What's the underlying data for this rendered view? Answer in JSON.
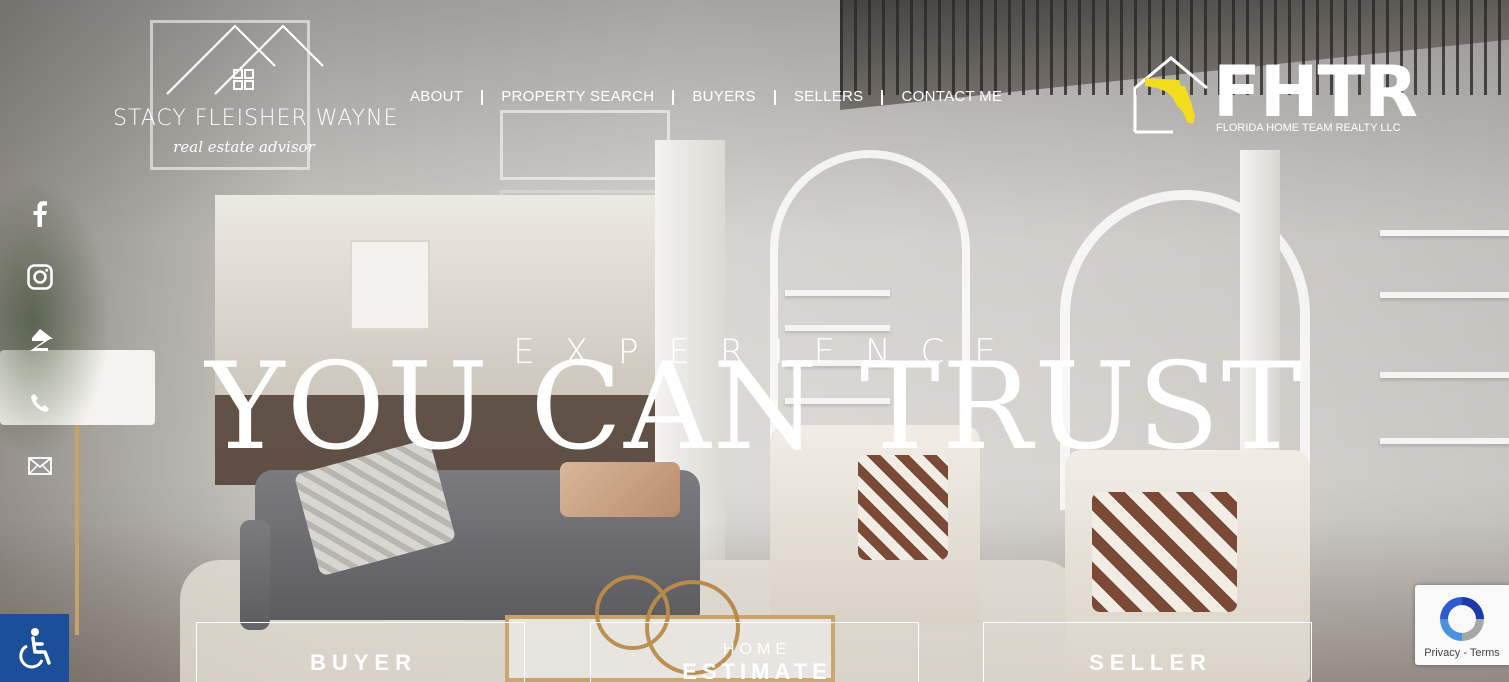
{
  "brand": {
    "name": "STACY FLEISHER WAYNE",
    "subtitle": "real estate advisor"
  },
  "nav": {
    "items": [
      {
        "label": "ABOUT"
      },
      {
        "label": "PROPERTY SEARCH"
      },
      {
        "label": "BUYERS"
      },
      {
        "label": "SELLERS"
      },
      {
        "label": "CONTACT ME"
      }
    ]
  },
  "partner": {
    "word": "FHTR",
    "tagline": "FLORIDA HOME TEAM REALTY LLC",
    "florida_color": "#f2dd1c"
  },
  "social": [
    "facebook-icon",
    "instagram-icon",
    "zillow-icon",
    "phone-icon",
    "mail-icon"
  ],
  "hero": {
    "kicker": "EXPERIENCE",
    "headline": "YOU CAN TRUST"
  },
  "cta": {
    "buyer": "BUYER",
    "home_small": "HOME",
    "home_big": "ESTIMATE",
    "seller": "SELLER"
  },
  "accessibility": {
    "color": "#1c4f9a"
  },
  "recaptcha": {
    "privacy": "Privacy",
    "sep": " - ",
    "terms": "Terms"
  }
}
